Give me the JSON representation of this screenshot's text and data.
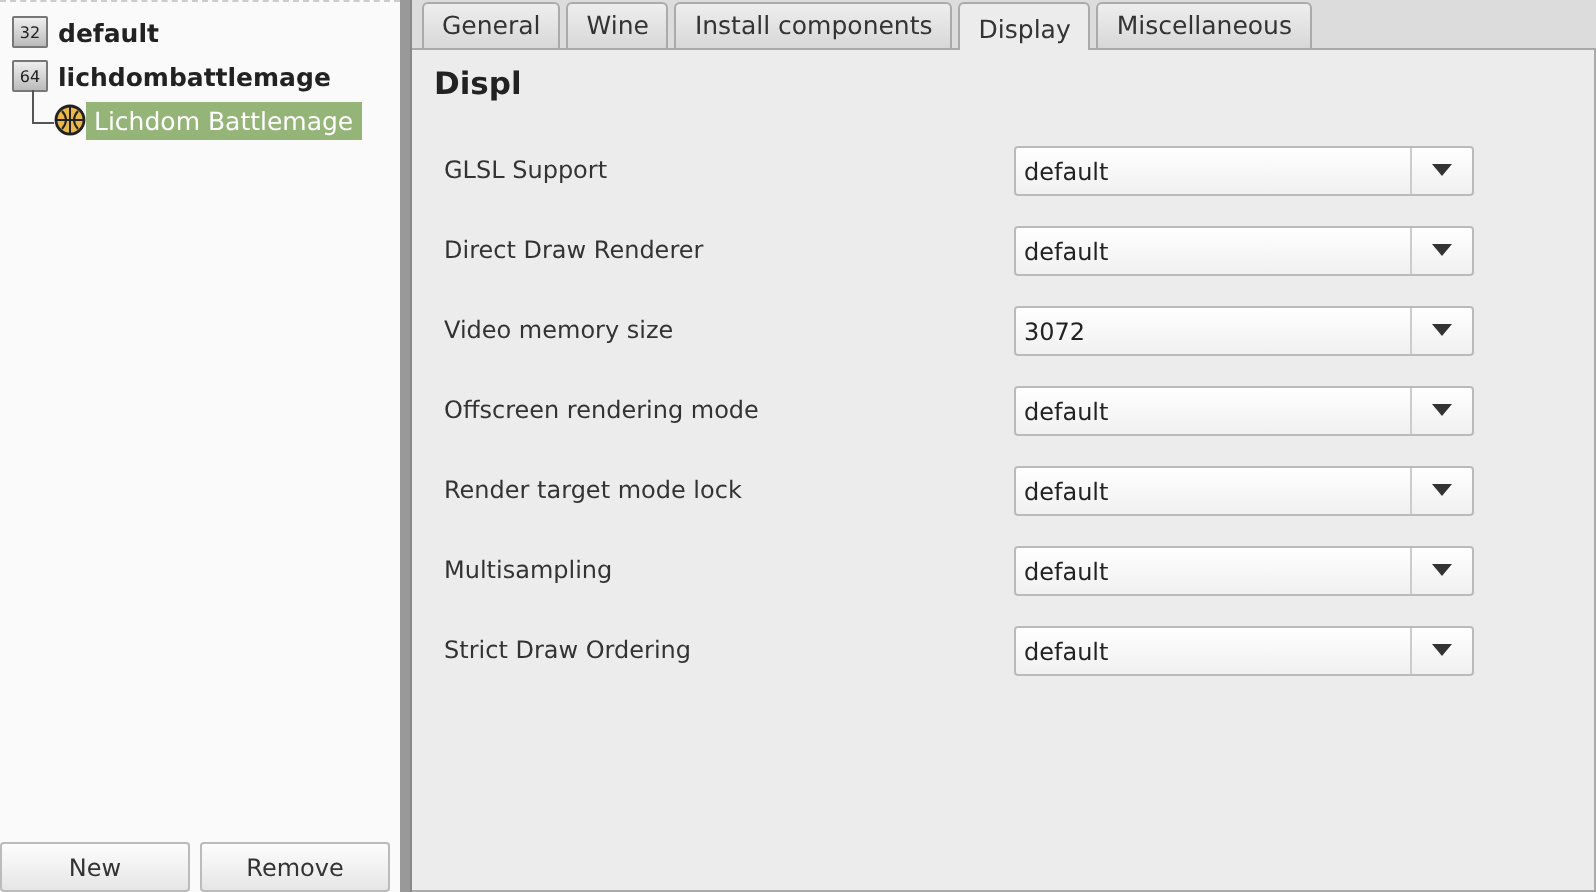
{
  "sidebar": {
    "items": [
      {
        "label": "default",
        "badge": "32",
        "selected": false
      },
      {
        "label": "lichdombattlemage",
        "badge": "64",
        "selected": false,
        "children": [
          {
            "label": "Lichdom Battlemage",
            "selected": true
          }
        ]
      }
    ],
    "buttons": [
      "New",
      "Remove"
    ]
  },
  "tabs": [
    {
      "label": "General",
      "selected": false
    },
    {
      "label": "Wine",
      "selected": false
    },
    {
      "label": "Install components",
      "selected": false
    },
    {
      "label": "Display",
      "selected": true
    },
    {
      "label": "Miscellaneous",
      "selected": false
    }
  ],
  "heading": "Displ",
  "settings": [
    {
      "label": "GLSL Support",
      "value": "default"
    },
    {
      "label": "Direct Draw Renderer",
      "value": "default"
    },
    {
      "label": "Video memory size",
      "value": "3072"
    },
    {
      "label": "Offscreen rendering mode",
      "value": "default"
    },
    {
      "label": "Render target mode lock",
      "value": "default"
    },
    {
      "label": "Multisampling",
      "value": "default"
    },
    {
      "label": "Strict Draw Ordering",
      "value": "default"
    }
  ]
}
